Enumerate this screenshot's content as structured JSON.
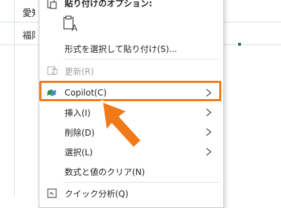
{
  "sheet": {
    "cells": [
      "愛知",
      "福岡"
    ]
  },
  "menu": {
    "paste_header": "貼り付けのオプション:",
    "paste_special": "形式を選択して貼り付け(S)...",
    "refresh": "更新(R)",
    "copilot": "Copilot(C)",
    "insert": "挿入(I)",
    "delete": "削除(D)",
    "select": "選択(L)",
    "clear": "数式と値のクリア(N)",
    "quick_analysis": "クイック分析(Q)"
  },
  "colors": {
    "highlight": "#f07a1a",
    "copilot_green": "#2f8f4e",
    "copilot_blue": "#2b7bd4"
  },
  "icons": {
    "paste": "clipboard-icon",
    "paste_option": "paste-values-icon",
    "refresh": "refresh-icon",
    "copilot": "copilot-icon",
    "submenu": "chevron-right-icon",
    "quick_analysis": "quick-analysis-icon"
  }
}
